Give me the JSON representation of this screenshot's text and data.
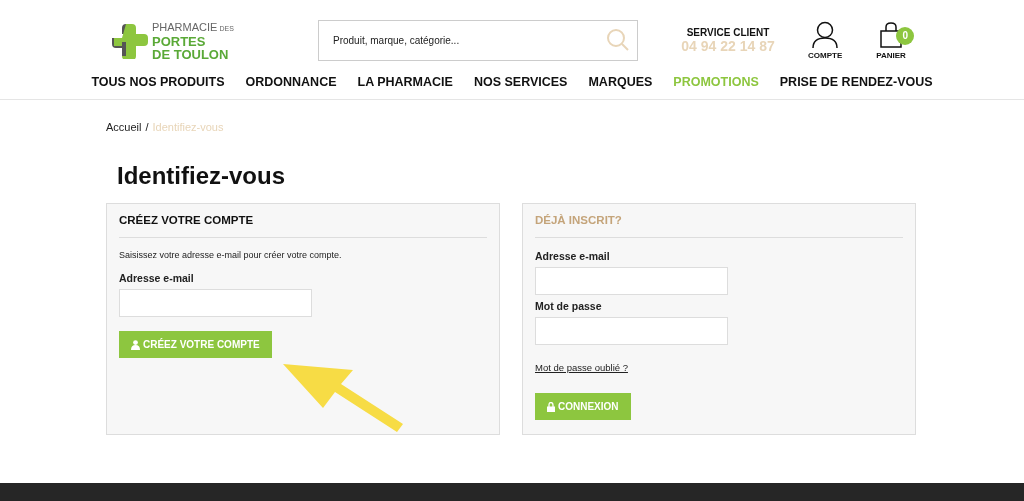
{
  "logo": {
    "line_1": "PHARMACIE",
    "line_1_small": "DES",
    "line_2": "PORTES",
    "line_3": "DE TOULON"
  },
  "search": {
    "placeholder": "Produit, marque, catégorie..."
  },
  "service": {
    "label": "SERVICE CLIENT",
    "phone": "04 94 22 14 87"
  },
  "account": {
    "label": "COMPTE"
  },
  "cart": {
    "label": "PANIER",
    "count": "0"
  },
  "nav": [
    {
      "label": "TOUS NOS PRODUITS",
      "kind": "normal"
    },
    {
      "label": "ORDONNANCE",
      "kind": "normal"
    },
    {
      "label": "LA PHARMACIE",
      "kind": "normal"
    },
    {
      "label": "NOS SERVICES",
      "kind": "normal"
    },
    {
      "label": "MARQUES",
      "kind": "normal"
    },
    {
      "label": "PROMOTIONS",
      "kind": "promo"
    },
    {
      "label": "PRISE DE RENDEZ-VOUS",
      "kind": "normal"
    }
  ],
  "breadcrumb": [
    {
      "label": "Accueil",
      "current": false
    },
    {
      "label": "Identifiez-vous",
      "current": true
    }
  ],
  "breadcrumb_separator": "/",
  "title": "Identifiez-vous",
  "create_panel": {
    "heading": "CRÉEZ VOTRE COMPTE",
    "intro": "Saisissez votre adresse e-mail pour créer votre compte.",
    "email_label": "Adresse e-mail",
    "button": "CRÉEZ VOTRE COMPTE"
  },
  "login_panel": {
    "heading": "DÉJÀ INSCRIT?",
    "email_label": "Adresse e-mail",
    "password_label": "Mot de passe",
    "forgot_link": "Mot de passe oublié ?",
    "button": "CONNEXION"
  }
}
